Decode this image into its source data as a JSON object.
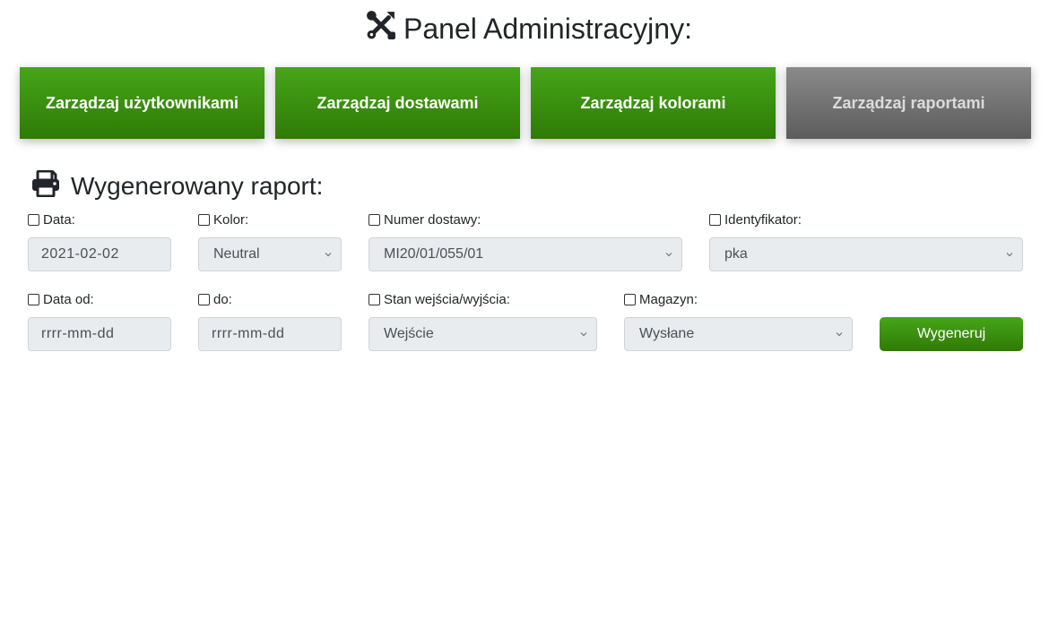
{
  "header": {
    "title": "Panel Administracyjny:",
    "icon": "tools-icon"
  },
  "nav": {
    "users": "Zarządzaj użytkownikami",
    "deliveries": "Zarządzaj dostawami",
    "colors": "Zarządzaj kolorami",
    "reports": "Zarządzaj raportami",
    "active_color": "#3a8f10",
    "inactive_color": "#707070"
  },
  "report": {
    "title": "Wygenerowany raport:",
    "icon": "printer-icon",
    "filters": {
      "date_label": "Data:",
      "date_value": "2021-02-02",
      "color_label": "Kolor:",
      "color_value": "Neutral",
      "delivery_label": "Numer dostawy:",
      "delivery_value": "MI20/01/055/01",
      "identifier_label": "Identyfikator:",
      "identifier_value": "pka",
      "date_from_label": "Data od:",
      "date_from_placeholder": "rrrr-mm-dd",
      "date_to_label": "do:",
      "date_to_placeholder": "rrrr-mm-dd",
      "state_label": "Stan wejścia/wyjścia:",
      "state_value": "Wejście",
      "warehouse_label": "Magazyn:",
      "warehouse_value": "Wysłane"
    },
    "generate_button": "Wygeneruj"
  }
}
